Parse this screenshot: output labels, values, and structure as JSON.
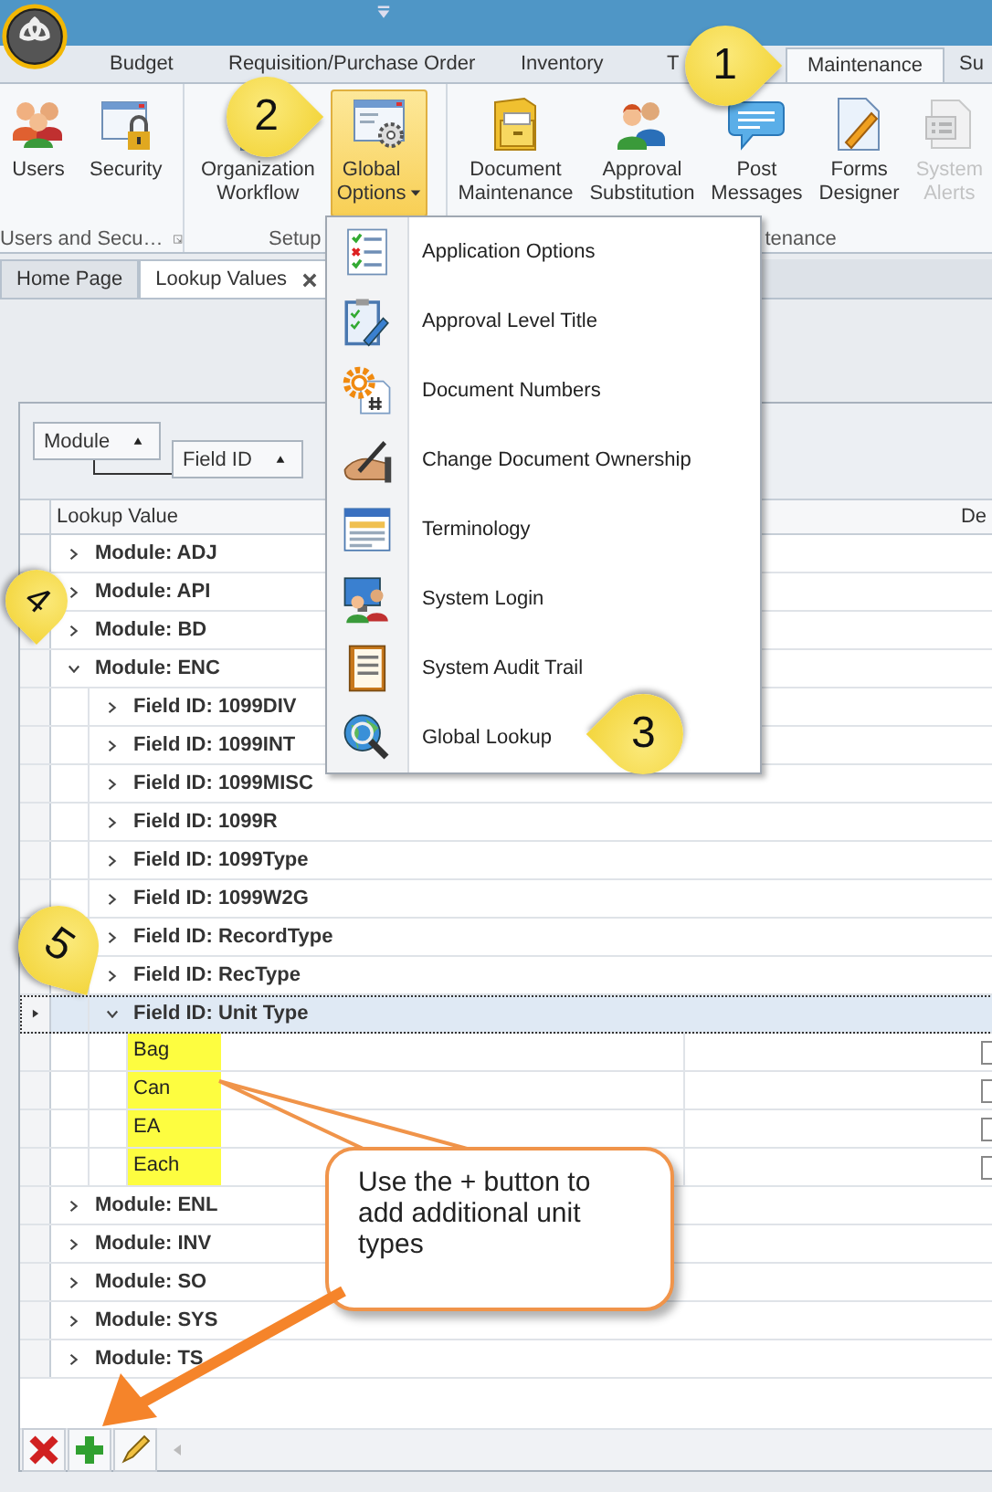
{
  "app_tabs": [
    {
      "label": "Budget",
      "selected": false
    },
    {
      "label": "Requisition/Purchase Order",
      "selected": false
    },
    {
      "label": "Inventory",
      "selected": false
    },
    {
      "label": "T",
      "selected": false
    },
    {
      "label": "Maintenance",
      "selected": true
    },
    {
      "label": "Su",
      "selected": false
    }
  ],
  "ribbon_groups": [
    {
      "label": "Users and Secu…",
      "buttons": [
        {
          "label": "Users",
          "pressed": false,
          "disabled": false,
          "dropdown": false
        },
        {
          "label": "Security",
          "pressed": false,
          "disabled": false,
          "dropdown": false
        }
      ]
    },
    {
      "label": "Setup",
      "buttons": [
        {
          "label": "Organization Workflow",
          "pressed": false,
          "disabled": false,
          "dropdown": false
        },
        {
          "label": "Global Options",
          "pressed": true,
          "disabled": false,
          "dropdown": true
        }
      ]
    },
    {
      "label": "tenance",
      "buttons": [
        {
          "label": "Document Maintenance",
          "pressed": false,
          "disabled": false,
          "dropdown": false
        },
        {
          "label": "Approval Substitution",
          "pressed": false,
          "disabled": false,
          "dropdown": false
        },
        {
          "label": "Post Messages",
          "pressed": false,
          "disabled": false,
          "dropdown": false
        },
        {
          "label": "Forms Designer",
          "pressed": false,
          "disabled": false,
          "dropdown": false
        },
        {
          "label": "System Alerts",
          "pressed": false,
          "disabled": true,
          "dropdown": false
        }
      ]
    }
  ],
  "doc_tabs": [
    {
      "label": "Home Page",
      "selected": false,
      "closable": false
    },
    {
      "label": "Lookup Values",
      "selected": true,
      "closable": true
    }
  ],
  "group_by": [
    "Module",
    "Field ID"
  ],
  "grid": {
    "columns": [
      "Lookup Value",
      "De"
    ],
    "rows": [
      {
        "kind": "group",
        "text": "Module: ADJ",
        "expanded": false,
        "selected": false
      },
      {
        "kind": "group",
        "text": "Module: API",
        "expanded": false,
        "selected": false
      },
      {
        "kind": "group",
        "text": "Module: BD",
        "expanded": false,
        "selected": false
      },
      {
        "kind": "group",
        "text": "Module: ENC",
        "expanded": true,
        "selected": false,
        "children": [
          {
            "kind": "group",
            "text": "Field ID: 1099DIV",
            "expanded": false,
            "selected": false
          },
          {
            "kind": "group",
            "text": "Field ID: 1099INT",
            "expanded": false,
            "selected": false
          },
          {
            "kind": "group",
            "text": "Field ID: 1099MISC",
            "expanded": false,
            "selected": false
          },
          {
            "kind": "group",
            "text": "Field ID: 1099R",
            "expanded": false,
            "selected": false
          },
          {
            "kind": "group",
            "text": "Field ID: 1099Type",
            "expanded": false,
            "selected": false
          },
          {
            "kind": "group",
            "text": "Field ID: 1099W2G",
            "expanded": false,
            "selected": false
          },
          {
            "kind": "group",
            "text": "Field ID: RecordType",
            "expanded": false,
            "selected": false
          },
          {
            "kind": "group",
            "text": "Field ID: RecType",
            "expanded": false,
            "selected": false
          },
          {
            "kind": "group",
            "text": "Field ID: Unit Type",
            "expanded": true,
            "selected": true,
            "children": [
              {
                "kind": "value",
                "text": "Bag",
                "highlighted": true,
                "selected": false
              },
              {
                "kind": "value",
                "text": "Can",
                "highlighted": true,
                "selected": false
              },
              {
                "kind": "value",
                "text": "EA",
                "highlighted": true,
                "selected": false
              },
              {
                "kind": "value",
                "text": "Each",
                "highlighted": true,
                "selected": false
              }
            ]
          }
        ]
      },
      {
        "kind": "group",
        "text": "Module: ENL",
        "expanded": false,
        "selected": false
      },
      {
        "kind": "group",
        "text": "Module: INV",
        "expanded": false,
        "selected": false
      },
      {
        "kind": "group",
        "text": "Module: SO",
        "expanded": false,
        "selected": false
      },
      {
        "kind": "group",
        "text": "Module: SYS",
        "expanded": false,
        "selected": false
      },
      {
        "kind": "group",
        "text": "Module: TS",
        "expanded": false,
        "selected": false
      }
    ]
  },
  "menu": {
    "items": [
      {
        "label": "Application Options"
      },
      {
        "label": "Approval Level Title"
      },
      {
        "label": "Document Numbers"
      },
      {
        "label": "Change Document Ownership"
      },
      {
        "label": "Terminology"
      },
      {
        "label": "System Login"
      },
      {
        "label": "System Audit Trail"
      },
      {
        "label": "Global Lookup"
      }
    ]
  },
  "callouts": [
    {
      "number": "1"
    },
    {
      "number": "2"
    },
    {
      "number": "3"
    },
    {
      "number": "4"
    },
    {
      "number": "5"
    }
  ],
  "note": "Use the + button to add additional unit types"
}
